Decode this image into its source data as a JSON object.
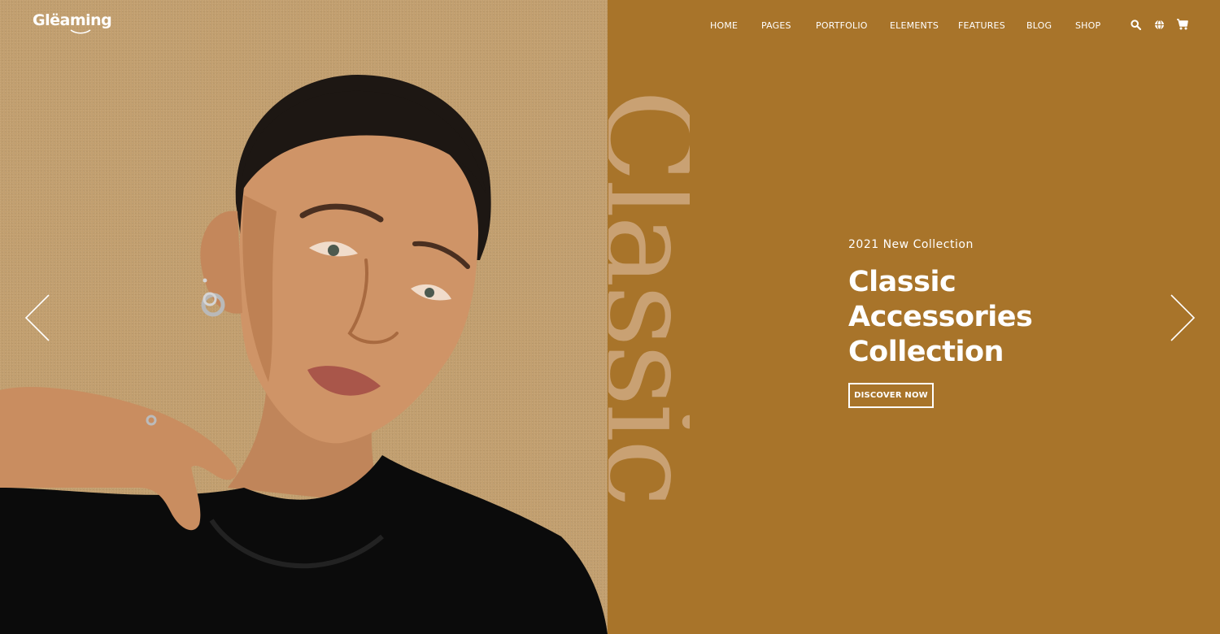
{
  "brand": {
    "logo_text": "Glëaming"
  },
  "nav": {
    "items": [
      {
        "label": "HOME"
      },
      {
        "label": "PAGES"
      },
      {
        "label": "PORTFOLIO"
      },
      {
        "label": "ELEMENTS"
      },
      {
        "label": "FEATURES"
      },
      {
        "label": "BLOG"
      },
      {
        "label": "SHOP"
      }
    ],
    "icons": [
      "search-icon",
      "globe-icon",
      "cart-icon"
    ]
  },
  "hero": {
    "vertical_word": "Classic",
    "eyebrow": "2021 New Collection",
    "headline_lines": [
      "Classic",
      "Accessories",
      "Collection"
    ],
    "cta_label": "DISCOVER NOW"
  },
  "slider": {
    "prev_icon": "chevron-left-icon",
    "next_icon": "chevron-right-icon"
  },
  "colors": {
    "left_bg": "#c29f6f",
    "right_bg": "#a8742a",
    "text": "#ffffff",
    "vertical_word": "#c9a173"
  }
}
